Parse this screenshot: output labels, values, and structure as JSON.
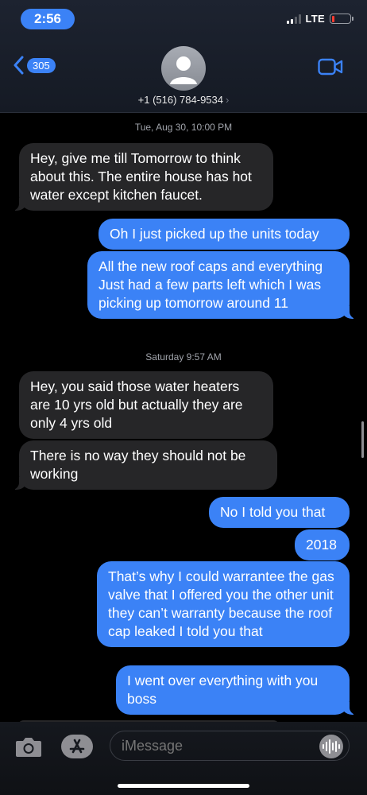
{
  "status_bar": {
    "time": "2:56",
    "network": "LTE",
    "battery_level": 0.08,
    "signal_bars": 2
  },
  "header": {
    "back_count": "305",
    "contact": "+1 (516) 784-9534",
    "chevron": "›"
  },
  "conversation": {
    "timestamps": [
      {
        "day": "Tue, Aug 30,",
        "time": "10:00 PM"
      },
      {
        "day": "Saturday",
        "time": "9:57 AM"
      }
    ],
    "messages": [
      {
        "from": "them",
        "text": "Hey, give me till Tomorrow to think about this. The entire house has hot water except kitchen faucet."
      },
      {
        "from": "me",
        "text": "Oh I just picked up the units today"
      },
      {
        "from": "me",
        "text": "All the new roof caps and everything Just had a few parts left which I was picking up tomorrow around 11"
      },
      {
        "from": "them",
        "text": "Hey, you said those water heaters are 10 yrs old but actually they are only 4 yrs old"
      },
      {
        "from": "them",
        "text": "There is no way they should not be working"
      },
      {
        "from": "me",
        "text": "No I told you that"
      },
      {
        "from": "me",
        "text": "2018"
      },
      {
        "from": "me",
        "text": "That’s why I could warrantee the gas valve that I offered you the other unit they can’t warranty because the roof cap leaked I told you that"
      },
      {
        "from": "me",
        "text": "I went over everything with you boss"
      }
    ]
  },
  "composer": {
    "placeholder": "iMessage"
  },
  "icons": [
    "back-chevron-icon",
    "avatar-icon",
    "video-camera-icon",
    "camera-icon",
    "app-store-icon",
    "audio-waveform-icon"
  ],
  "colors": {
    "outgoing": "#3b82f6",
    "incoming": "#262628",
    "background": "#000000",
    "accent": "#3b82f6"
  }
}
